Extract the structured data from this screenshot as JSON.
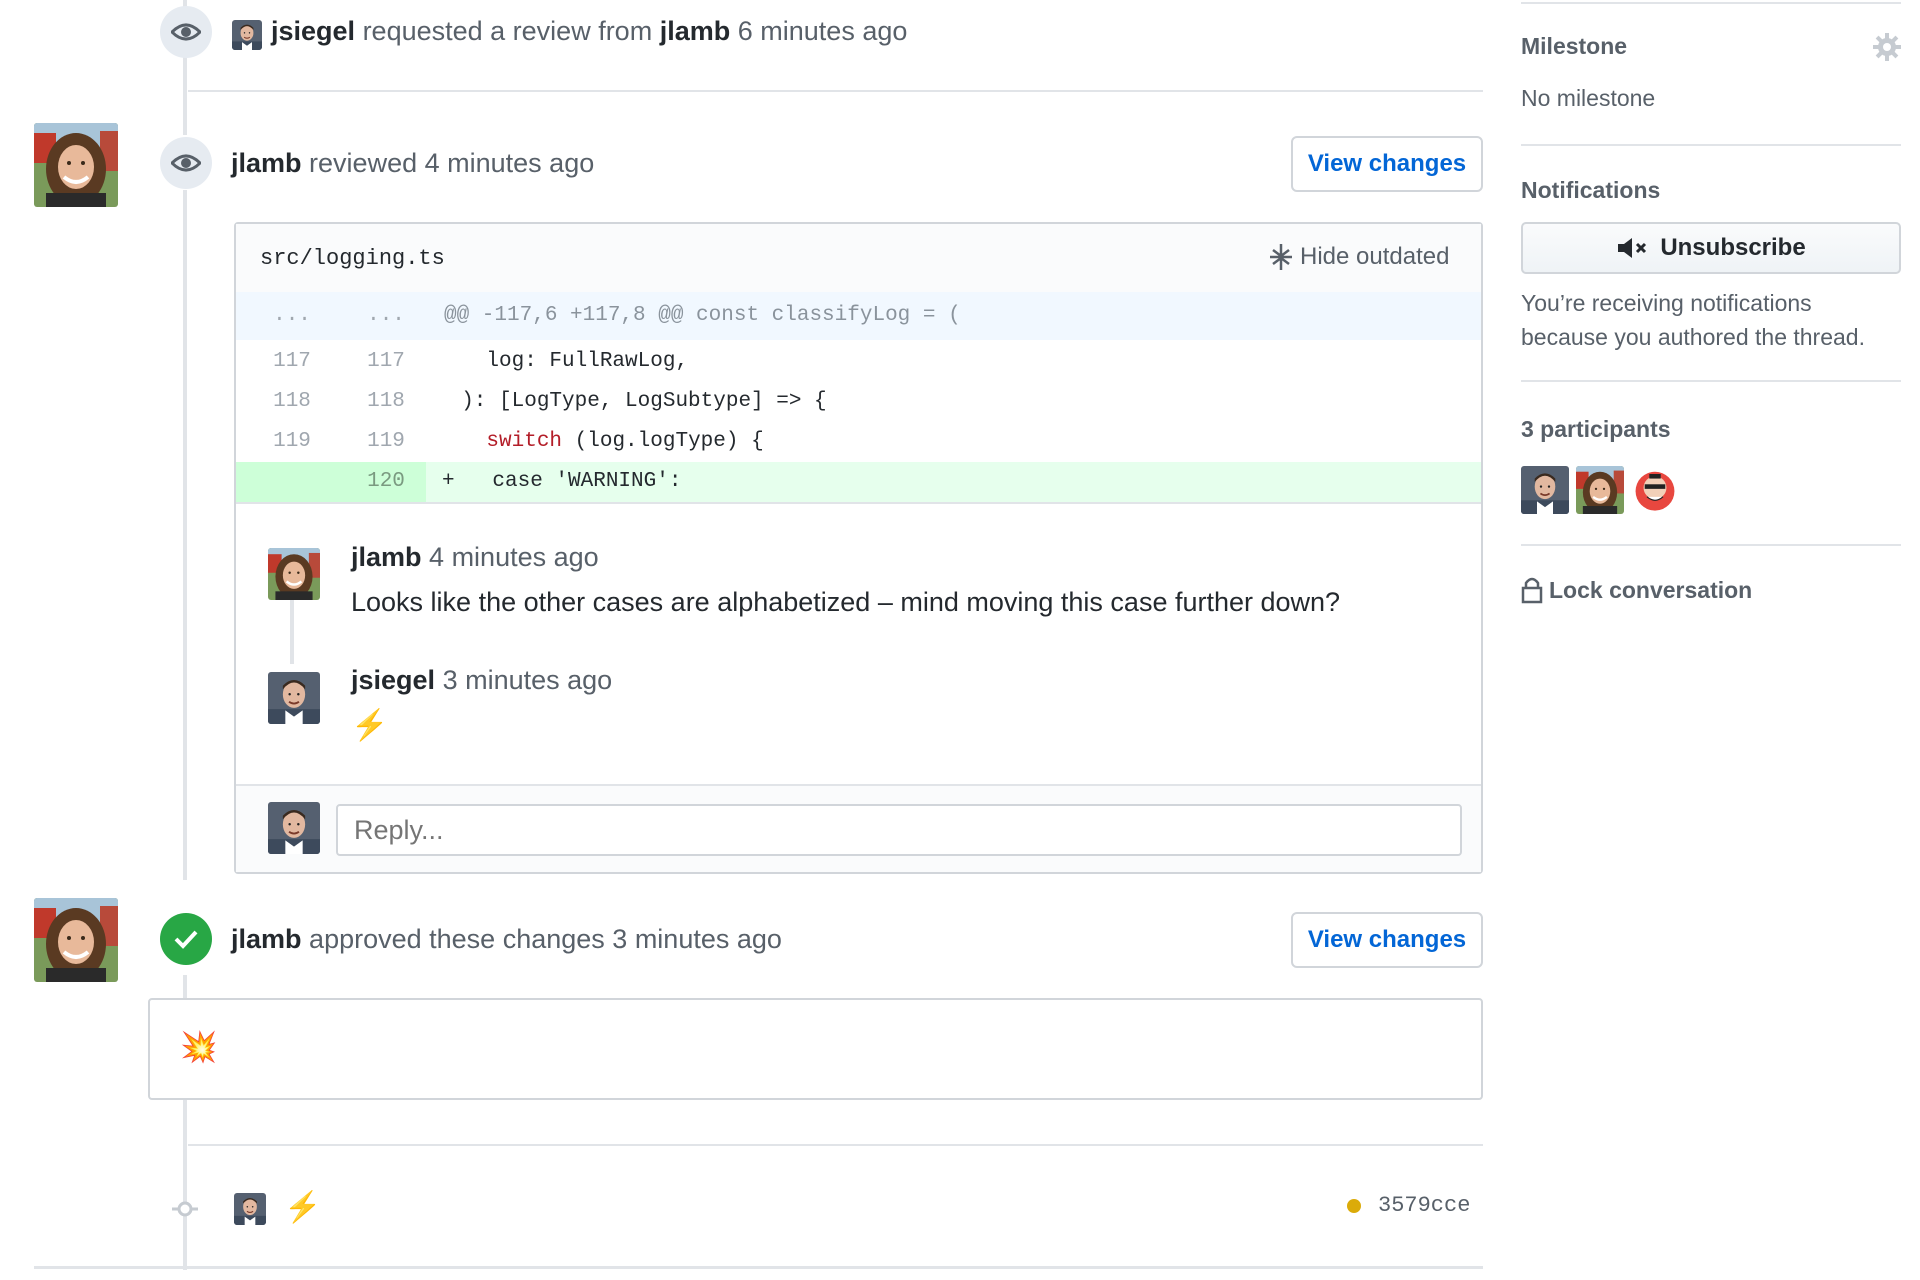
{
  "timeline": {
    "review_request": {
      "actor": "jsiegel",
      "action": "requested a review from",
      "reviewer": "jlamb",
      "time": "6 minutes ago"
    },
    "review": {
      "actor": "jlamb",
      "action": "reviewed",
      "time": "4 minutes ago",
      "view_changes_label": "View changes",
      "file": {
        "path": "src/logging.ts",
        "hide_outdated_label": "Hide outdated"
      },
      "diff": [
        {
          "old": "...",
          "new": "...",
          "code": "@@ -117,6 +117,8 @@ const classifyLog = (",
          "kind": "hunk"
        },
        {
          "old": "117",
          "new": "117",
          "code": "    log: FullRawLog,",
          "kind": "context"
        },
        {
          "old": "118",
          "new": "118",
          "code": "  ): [LogType, LogSubtype] => {",
          "kind": "context"
        },
        {
          "old": "119",
          "new": "119",
          "code_kw": "switch",
          "code_rest": " (log.logType) {",
          "prefix": "    ",
          "kind": "context-kw"
        },
        {
          "old": "",
          "new": "120",
          "code": "+   case 'WARNING':",
          "kind": "add"
        }
      ],
      "comments": [
        {
          "author": "jlamb",
          "time": "4 minutes ago",
          "body": "Looks like the other cases are alphabetized – mind moving this case further down?"
        },
        {
          "author": "jsiegel",
          "time": "3 minutes ago",
          "body": "⚡"
        }
      ],
      "reply_placeholder": "Reply..."
    },
    "approval": {
      "actor": "jlamb",
      "action": "approved these changes",
      "time": "3 minutes ago",
      "view_changes_label": "View changes",
      "body": "💥"
    },
    "commit": {
      "message": "⚡",
      "sha": "3579cce",
      "status_color": "#dbab09"
    }
  },
  "sidebar": {
    "milestone": {
      "heading": "Milestone",
      "value": "No milestone"
    },
    "notifications": {
      "heading": "Notifications",
      "button_label": "Unsubscribe",
      "reason_line1": "You’re receiving notifications",
      "reason_line2": "because you authored the thread."
    },
    "participants": {
      "heading": "3 participants"
    },
    "lock_label": "Lock conversation"
  },
  "colors": {
    "link": "#0366d6",
    "success": "#28a745",
    "addition_bg": "#e6ffed"
  }
}
